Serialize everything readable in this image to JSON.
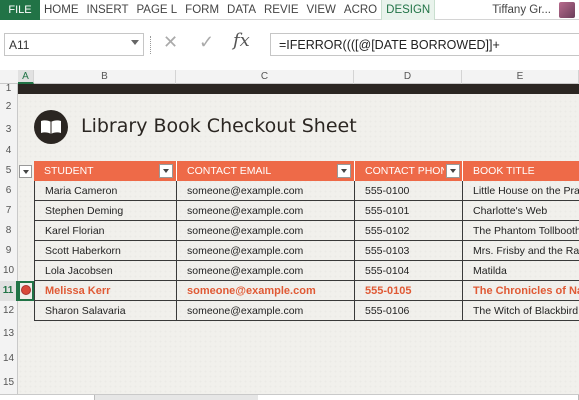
{
  "ribbon": {
    "file": "FILE",
    "tabs": [
      "HOME",
      "INSERT",
      "PAGE L",
      "FORM",
      "DATA",
      "REVIE",
      "VIEW",
      "ACRO",
      "DESIGN"
    ],
    "user": "Tiffany Gr..."
  },
  "formula_bar": {
    "name_box": "A11",
    "cancel_icon": "✕",
    "enter_icon": "✓",
    "fx": "fx",
    "formula": "=IFERROR((([@[DATE BORROWED]]+"
  },
  "columns": [
    "A",
    "B",
    "C",
    "D",
    "E"
  ],
  "rows": [
    "1",
    "2",
    "3",
    "4",
    "5",
    "6",
    "7",
    "8",
    "9",
    "10",
    "11",
    "12",
    "13",
    "14",
    "15"
  ],
  "sheet": {
    "title": "Library Book Checkout Sheet",
    "headers": [
      "STUDENT",
      "CONTACT EMAIL",
      "CONTACT PHONE",
      "BOOK TITLE"
    ],
    "records": [
      [
        "Maria Cameron",
        "someone@example.com",
        "555-0100",
        "Little House on the Prairie"
      ],
      [
        "Stephen Deming",
        "someone@example.com",
        "555-0101",
        "Charlotte's Web"
      ],
      [
        "Karel Florian",
        "someone@example.com",
        "555-0102",
        "The Phantom Tollbooth"
      ],
      [
        "Scott Haberkorn",
        "someone@example.com",
        "555-0103",
        "Mrs. Frisby and the Rats"
      ],
      [
        "Lola Jacobsen",
        "someone@example.com",
        "555-0104",
        "Matilda"
      ],
      [
        "Melissa Kerr",
        "someone@example.com",
        "555-0105",
        "The Chronicles of Narnia"
      ],
      [
        "Sharon Salavaria",
        "someone@example.com",
        "555-0106",
        "The Witch of Blackbird Pond"
      ]
    ],
    "active_record_index": 5
  },
  "colors": {
    "excel_green": "#217346",
    "header_orange": "#ee6a48",
    "dark_band": "#2b2622",
    "overdue_text": "#e05a35"
  }
}
